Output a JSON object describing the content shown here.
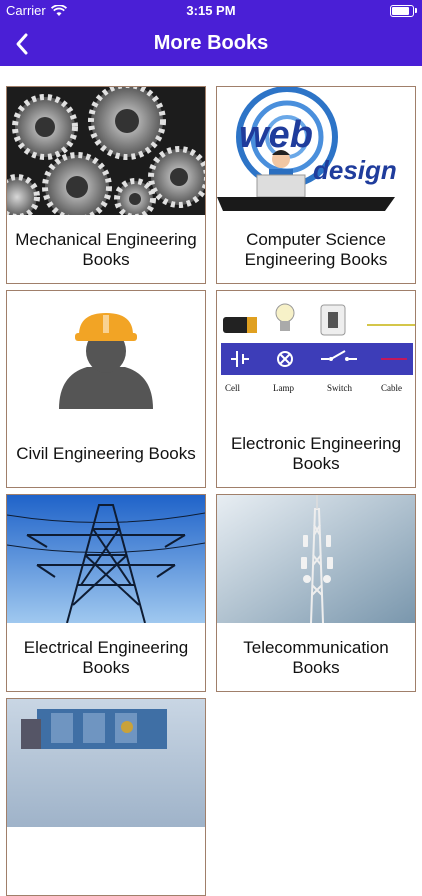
{
  "status_bar": {
    "carrier": "Carrier",
    "time": "3:15 PM",
    "battery_level": 0.9
  },
  "nav": {
    "title": "More Books",
    "back_icon": "chevron-left-icon"
  },
  "colors": {
    "header": "#4a1fd6",
    "card_border": "#a07f6a"
  },
  "books": [
    {
      "label": "Mechanical Engineering Books",
      "image": "gears-image"
    },
    {
      "label": "Computer Science Engineering Books",
      "image": "web-design-image",
      "image_text": "web design"
    },
    {
      "label": "Civil Engineering Books",
      "image": "hard-hat-worker-image"
    },
    {
      "label": "Electronic Engineering Books",
      "image": "circuit-symbols-image",
      "image_text": [
        "Cell",
        "Lamp",
        "Switch",
        "Cable"
      ]
    },
    {
      "label": "Electrical Engineering Books",
      "image": "transmission-tower-image"
    },
    {
      "label": "Telecommunication Books",
      "image": "cell-tower-image"
    },
    {
      "label": "",
      "image": "industrial-machine-image"
    }
  ]
}
